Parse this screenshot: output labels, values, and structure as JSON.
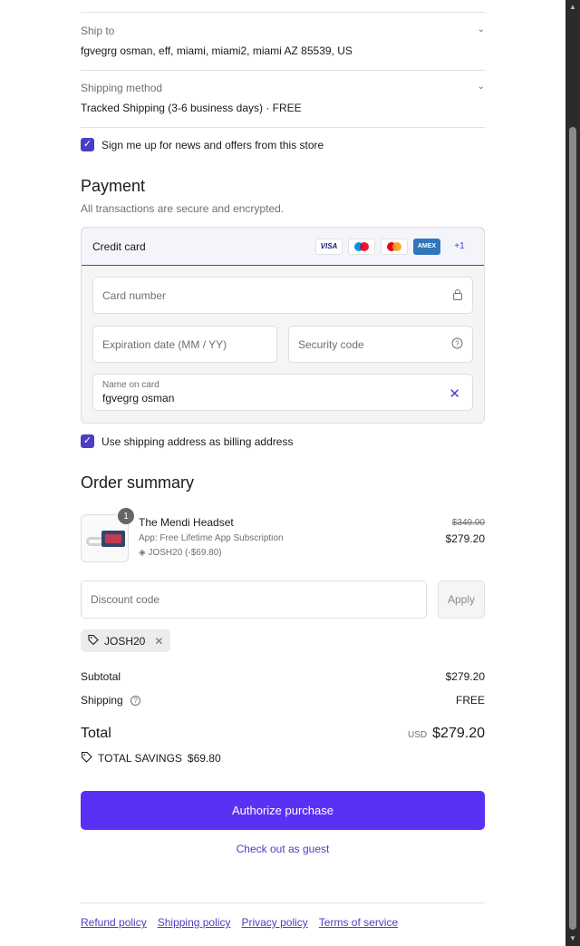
{
  "ship_to": {
    "label": "Ship to",
    "value": "fgvegrg osman, eff, miami, miami2, miami AZ 85539, US"
  },
  "shipping_method": {
    "label": "Shipping method",
    "value": "Tracked Shipping (3-6 business days) · FREE"
  },
  "newsletter": {
    "label": "Sign me up for news and offers from this store",
    "checked": true
  },
  "payment": {
    "title": "Payment",
    "subtitle": "All transactions are secure and encrypted.",
    "method_label": "Credit card",
    "brands": [
      "VISA",
      "maestro",
      "mastercard",
      "AMEX"
    ],
    "more_brands": "+1",
    "card_number_placeholder": "Card number",
    "expiry_placeholder": "Expiration date (MM / YY)",
    "security_placeholder": "Security code",
    "name_label": "Name on card",
    "name_value": "fgvegrg osman"
  },
  "billing_same": {
    "label": "Use shipping address as billing address",
    "checked": true
  },
  "summary": {
    "title": "Order summary",
    "item": {
      "quantity": "1",
      "name": "The Mendi Headset",
      "meta": "App: Free Lifetime App Subscription",
      "discount": "JOSH20 (-$69.80)",
      "original_price": "$349.00",
      "price": "$279.20"
    },
    "discount_placeholder": "Discount code",
    "apply_label": "Apply",
    "applied_code": "JOSH20",
    "subtotal_label": "Subtotal",
    "subtotal_value": "$279.20",
    "shipping_label": "Shipping",
    "shipping_value": "FREE",
    "total_label": "Total",
    "currency": "USD",
    "total_value": "$279.20",
    "savings_label": "TOTAL SAVINGS",
    "savings_value": "$69.80"
  },
  "actions": {
    "authorize": "Authorize purchase",
    "guest": "Check out as guest"
  },
  "footer": [
    "Refund policy",
    "Shipping policy",
    "Privacy policy",
    "Terms of service"
  ],
  "colors": {
    "accent": "#5a31f4",
    "link": "#4a3fc4"
  }
}
